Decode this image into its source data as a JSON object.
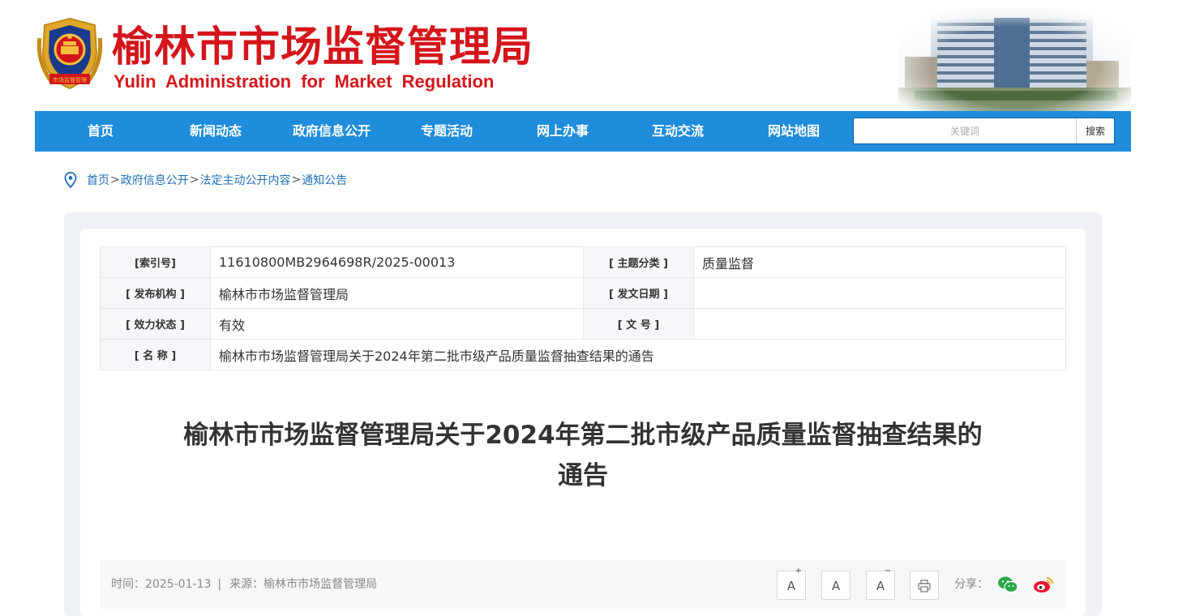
{
  "header": {
    "title_cn": "榆林市市场监督管理局",
    "title_en": "Yulin Administration  for  Market  Regulation",
    "emblem_text": "市场监督管理"
  },
  "nav": {
    "items": [
      "首页",
      "新闻动态",
      "政府信息公开",
      "专题活动",
      "网上办事",
      "互动交流",
      "网站地图"
    ],
    "search_placeholder": "关键词",
    "search_button": "搜索"
  },
  "breadcrumb": {
    "items": [
      "首页",
      "政府信息公开",
      "法定主动公开内容",
      "通知公告"
    ],
    "separator": ">"
  },
  "meta": {
    "index_label": "[索引号]",
    "index_value": "11610800MB2964698R/2025-00013",
    "category_label": "[ 主题分类 ]",
    "category_value": "质量监督",
    "publisher_label": "[ 发布机构 ]",
    "publisher_value": "榆林市市场监督管理局",
    "date_label": "[ 发文日期 ]",
    "date_value": "",
    "status_label": "[ 效力状态 ]",
    "status_value": "有效",
    "docno_label": "[ 文 号 ]",
    "docno_value": "",
    "name_label": "[ 名 称 ]",
    "name_value": "榆林市市场监督管理局关于2024年第二批市级产品质量监督抽查结果的通告"
  },
  "article": {
    "title_line1": "榆林市市场监督管理局关于2024年第二批市级产品质量监督抽查结果的",
    "title_line2": "通告"
  },
  "toolbar": {
    "time_text": "时间：2025-01-13",
    "divider": "|",
    "source_text": "来源：榆林市市场监督管理局",
    "font_large": "A",
    "font_large_sup": "+",
    "font_normal": "A",
    "font_small": "A",
    "font_small_sup": "−",
    "share_label": "分享："
  },
  "colors": {
    "brand_red": "#d4161c",
    "nav_blue": "#1f8ddb",
    "link_blue": "#1f6fb5",
    "wechat_green": "#2aa84a",
    "weibo_red": "#e6162d"
  },
  "icons": [
    "location-pin-icon",
    "print-icon",
    "wechat-icon",
    "weibo-icon"
  ]
}
